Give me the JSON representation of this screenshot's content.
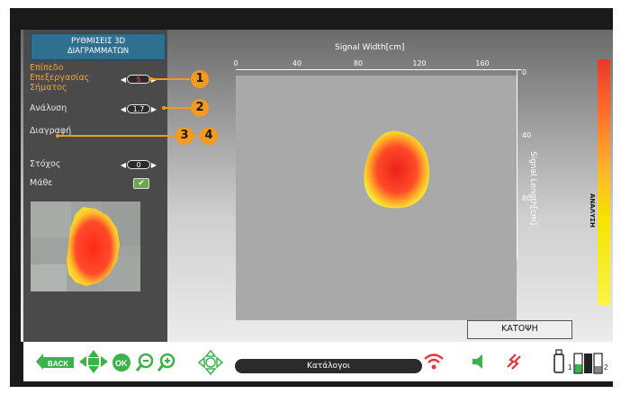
{
  "sidebar": {
    "title_line1": "ΡΥΘΜΙΣΕΙΣ 3D",
    "title_line2": "ΔΙΑΓΡΑΜΜΑΤΩΝ",
    "processing_label_line1": "Επίπεδο",
    "processing_label_line2": "Επεξεργασίας",
    "processing_label_line3": "Σήματος",
    "processing_value": "5",
    "resolution_label": "Ανάλυση",
    "resolution_value": "1.7",
    "delete_label": "Διαγραφή",
    "target_label": "Στόχος",
    "target_value": "0",
    "learn_label": "Μάθε",
    "learn_checked": true
  },
  "plot": {
    "x_axis_title": "Signal Width[cm]",
    "x_ticks": [
      "0",
      "40",
      "80",
      "120",
      "160"
    ],
    "y_axis_title": "Signal Length[cm]",
    "y_ticks": [
      "0",
      "40",
      "80"
    ],
    "scale_label": "ΑΝΑΛΥΣΗ"
  },
  "view_button": "ΚΑΤΟΨΗ",
  "bottom": {
    "back_label": "BACK",
    "ok_label": "OK",
    "catalog_label": "Κατάλογοι",
    "battery1_label": "1",
    "battery2_label": "2"
  },
  "callouts": [
    "1",
    "2",
    "3",
    "4"
  ],
  "colors": {
    "accent_orange": "#f39a1f",
    "title_blue": "#2f6f8f",
    "icon_green": "#3cb34a",
    "wifi_red": "#e8333a"
  }
}
